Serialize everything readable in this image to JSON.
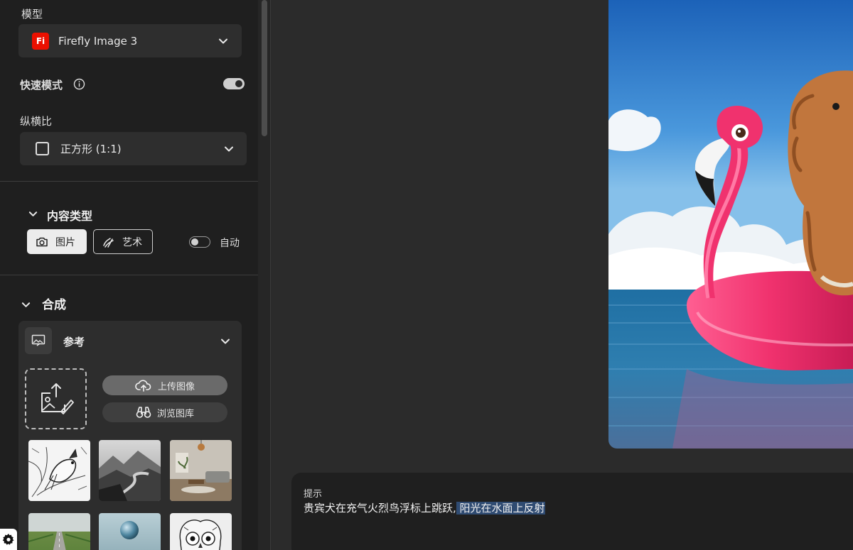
{
  "sidebar": {
    "model": {
      "label": "模型",
      "selected": "Firefly Image 3",
      "logo_text": "Fi"
    },
    "fast_mode": {
      "label": "快速模式",
      "enabled": true
    },
    "aspect_ratio": {
      "label": "纵横比",
      "selected": "正方形 (1:1)"
    },
    "content_type": {
      "label": "内容类型",
      "options": [
        {
          "label": "图片",
          "icon": "camera-icon",
          "active": true
        },
        {
          "label": "艺术",
          "icon": "art-brush-icon",
          "active": false
        }
      ],
      "auto_label": "自动",
      "auto_enabled": false
    },
    "composition": {
      "label": "合成",
      "reference": {
        "label": "参考",
        "upload_button": "上传图像",
        "browse_button": "浏览图库",
        "thumbnails": [
          "sketch-bird",
          "misty-mountains",
          "living-room",
          "green-road",
          "blue-sphere",
          "owl-sketch"
        ]
      }
    }
  },
  "prompt": {
    "label": "提示",
    "text_plain": "贵宾犬在充气火烈鸟浮标上跳跃,",
    "text_selected": " 阳光在水面上反射"
  },
  "colors": {
    "accent_logo": "#eb1000",
    "selection": "#2f4b72",
    "flamingo_pink": "#f0326e"
  }
}
